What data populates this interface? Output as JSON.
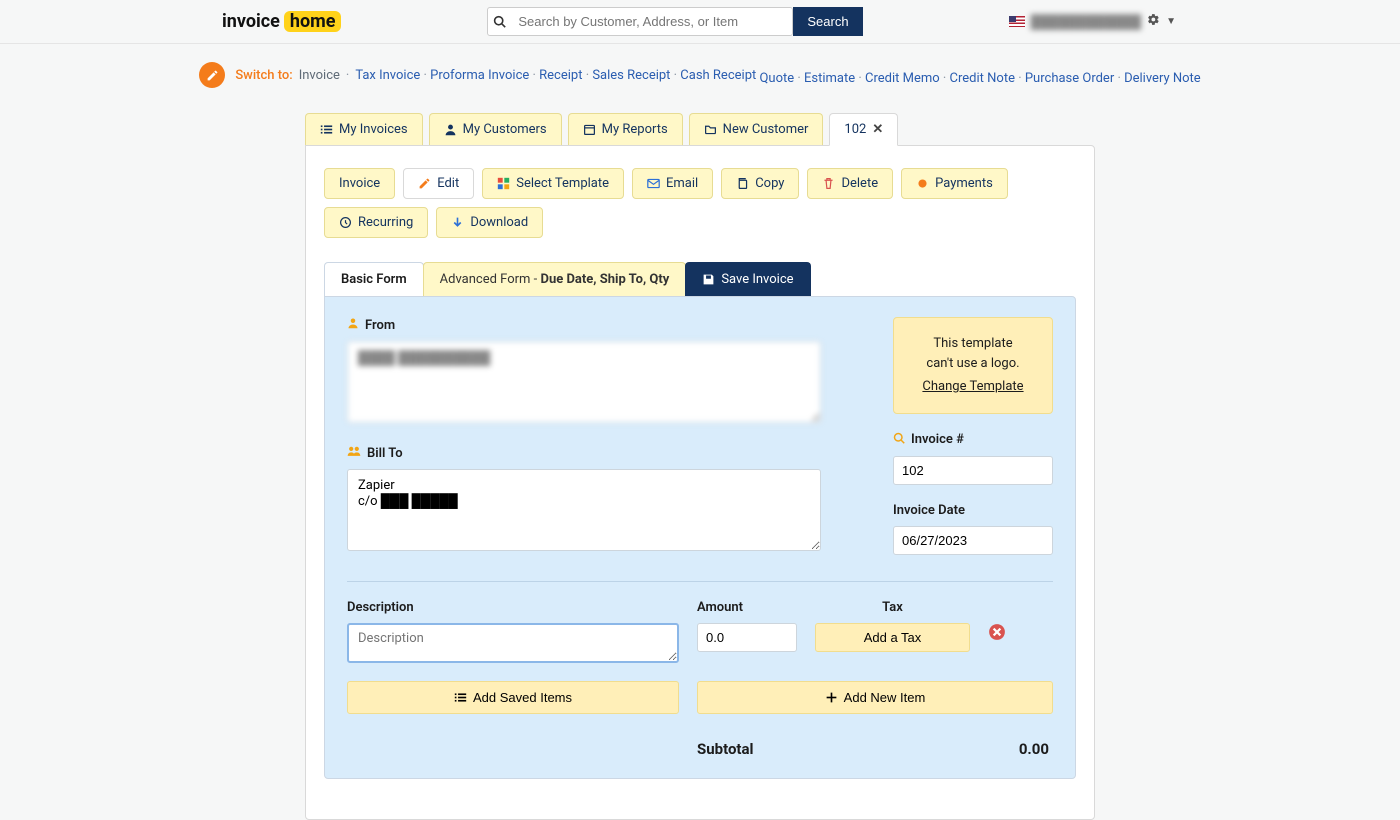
{
  "brand": {
    "part1": "invoice",
    "part2": "home"
  },
  "search": {
    "placeholder": "Search by Customer, Address, or Item",
    "button": "Search"
  },
  "user": {
    "name": "████████████"
  },
  "switch": {
    "label": "Switch to:",
    "current": "Invoice",
    "links_row1": [
      "Tax Invoice",
      "Proforma Invoice",
      "Receipt",
      "Sales Receipt",
      "Cash Receipt"
    ],
    "links_row2": [
      "Quote",
      "Estimate",
      "Credit Memo",
      "Credit Note",
      "Purchase Order",
      "Delivery Note"
    ]
  },
  "main_tabs": {
    "invoices": "My Invoices",
    "customers": "My Customers",
    "reports": "My Reports",
    "new_customer": "New Customer",
    "active": "102"
  },
  "actions": {
    "invoice": "Invoice",
    "edit": "Edit",
    "select_template": "Select Template",
    "email": "Email",
    "copy": "Copy",
    "delete": "Delete",
    "payments": "Payments",
    "recurring": "Recurring",
    "download": "Download"
  },
  "form_tabs": {
    "basic": "Basic Form",
    "advanced_prefix": "Advanced Form - ",
    "advanced_bold": "Due Date, Ship To, Qty",
    "save": "Save Invoice"
  },
  "form": {
    "from_label": "From",
    "from_value": "████ ██████████",
    "bill_to_label": "Bill To",
    "bill_to_value": "Zapier\nc/o ███ █████",
    "template_note_line1": "This template",
    "template_note_line2": "can't use a logo.",
    "template_note_link": "Change Template",
    "invoice_num_label": "Invoice #",
    "invoice_num_value": "102",
    "invoice_date_label": "Invoice Date",
    "invoice_date_value": "06/27/2023"
  },
  "line": {
    "desc_label": "Description",
    "amount_label": "Amount",
    "tax_label": "Tax",
    "desc_placeholder": "Description",
    "amount_value": "0.0",
    "add_tax": "Add a Tax",
    "add_saved": "Add Saved Items",
    "add_new": "Add New Item"
  },
  "totals": {
    "subtotal_label": "Subtotal",
    "subtotal_value": "0.00"
  }
}
